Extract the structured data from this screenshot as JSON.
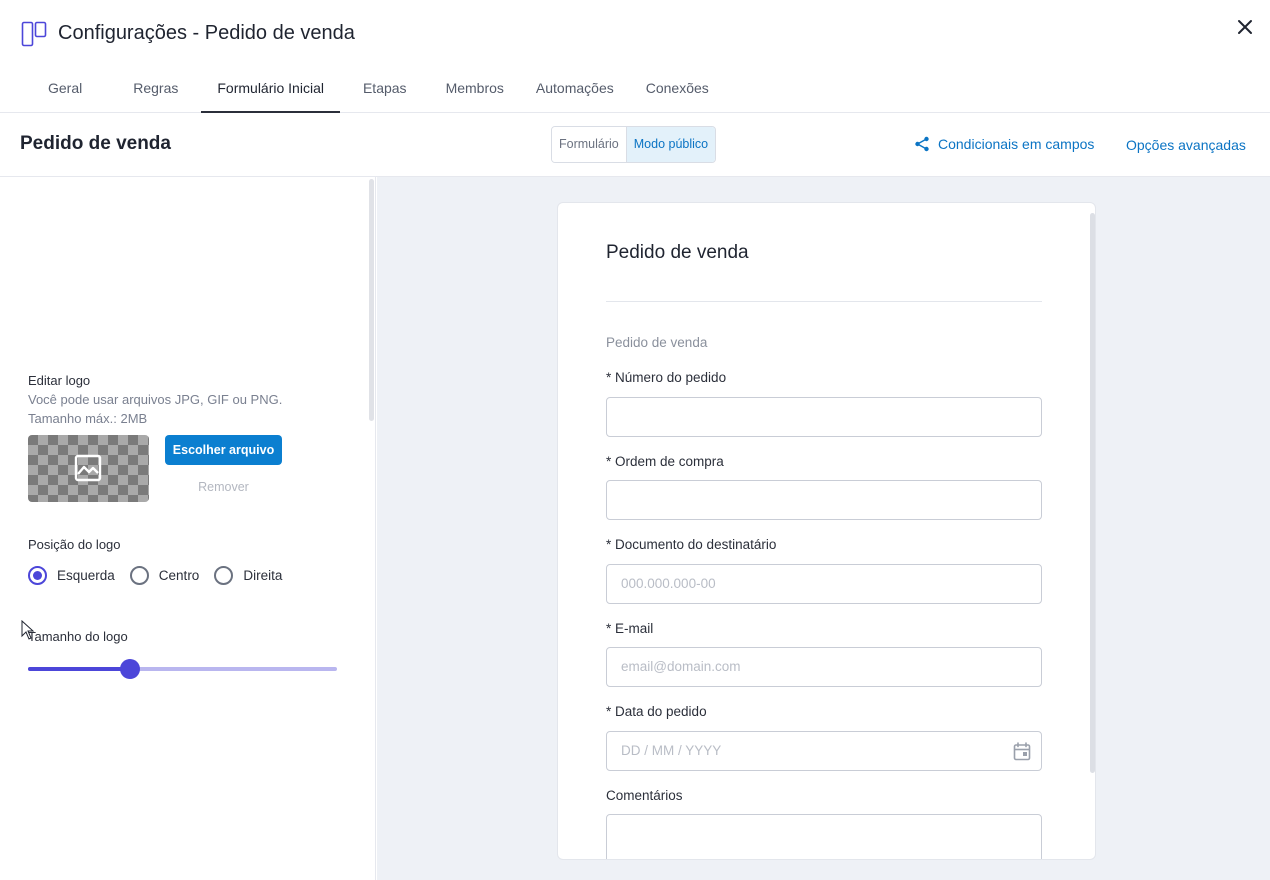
{
  "header": {
    "title": "Configurações - Pedido de venda",
    "tabs": [
      {
        "label": "Geral"
      },
      {
        "label": "Regras"
      },
      {
        "label": "Formulário Inicial"
      },
      {
        "label": "Etapas"
      },
      {
        "label": "Membros"
      },
      {
        "label": "Automações"
      },
      {
        "label": "Conexões"
      }
    ],
    "active_tab": "Formulário Inicial"
  },
  "subheader": {
    "title": "Pedido de venda",
    "toggle": {
      "options": [
        "Formulário",
        "Modo público"
      ],
      "selected": "Modo público"
    },
    "conditional_link": "Condicionais em campos",
    "advanced_link": "Opções avançadas"
  },
  "left_panel": {
    "edit_logo_label": "Editar logo",
    "hint_line1": "Você pode usar arquivos JPG, GIF ou PNG.",
    "hint_line2": "Tamanho máx.: 2MB",
    "choose_file": "Escolher arquivo",
    "remove": "Remover",
    "position_label": "Posição do logo",
    "positions": [
      "Esquerda",
      "Centro",
      "Direita"
    ],
    "selected_position": "Esquerda",
    "size_label": "Tamanho do logo",
    "size_fraction": 0.33
  },
  "form": {
    "title": "Pedido de venda",
    "subtitle": "Pedido de venda",
    "fields": [
      {
        "label": "* Número do pedido",
        "placeholder": ""
      },
      {
        "label": "* Ordem de compra",
        "placeholder": ""
      },
      {
        "label": "* Documento do destinatário",
        "placeholder": "000.000.000-00"
      },
      {
        "label": "* E-mail",
        "placeholder": "email@domain.com"
      },
      {
        "label": "* Data do pedido",
        "placeholder": "DD / MM / YYYY"
      },
      {
        "label": "Comentários",
        "placeholder": ""
      }
    ]
  },
  "colors": {
    "accent": "#4c46d9",
    "link": "#0b74c4",
    "primary_button": "#0b7fd0"
  },
  "icons": {
    "app": "kanban-icon",
    "close": "close-icon",
    "conditional": "share-nodes-icon",
    "logo_placeholder": "image-icon",
    "date": "calendar-icon"
  }
}
